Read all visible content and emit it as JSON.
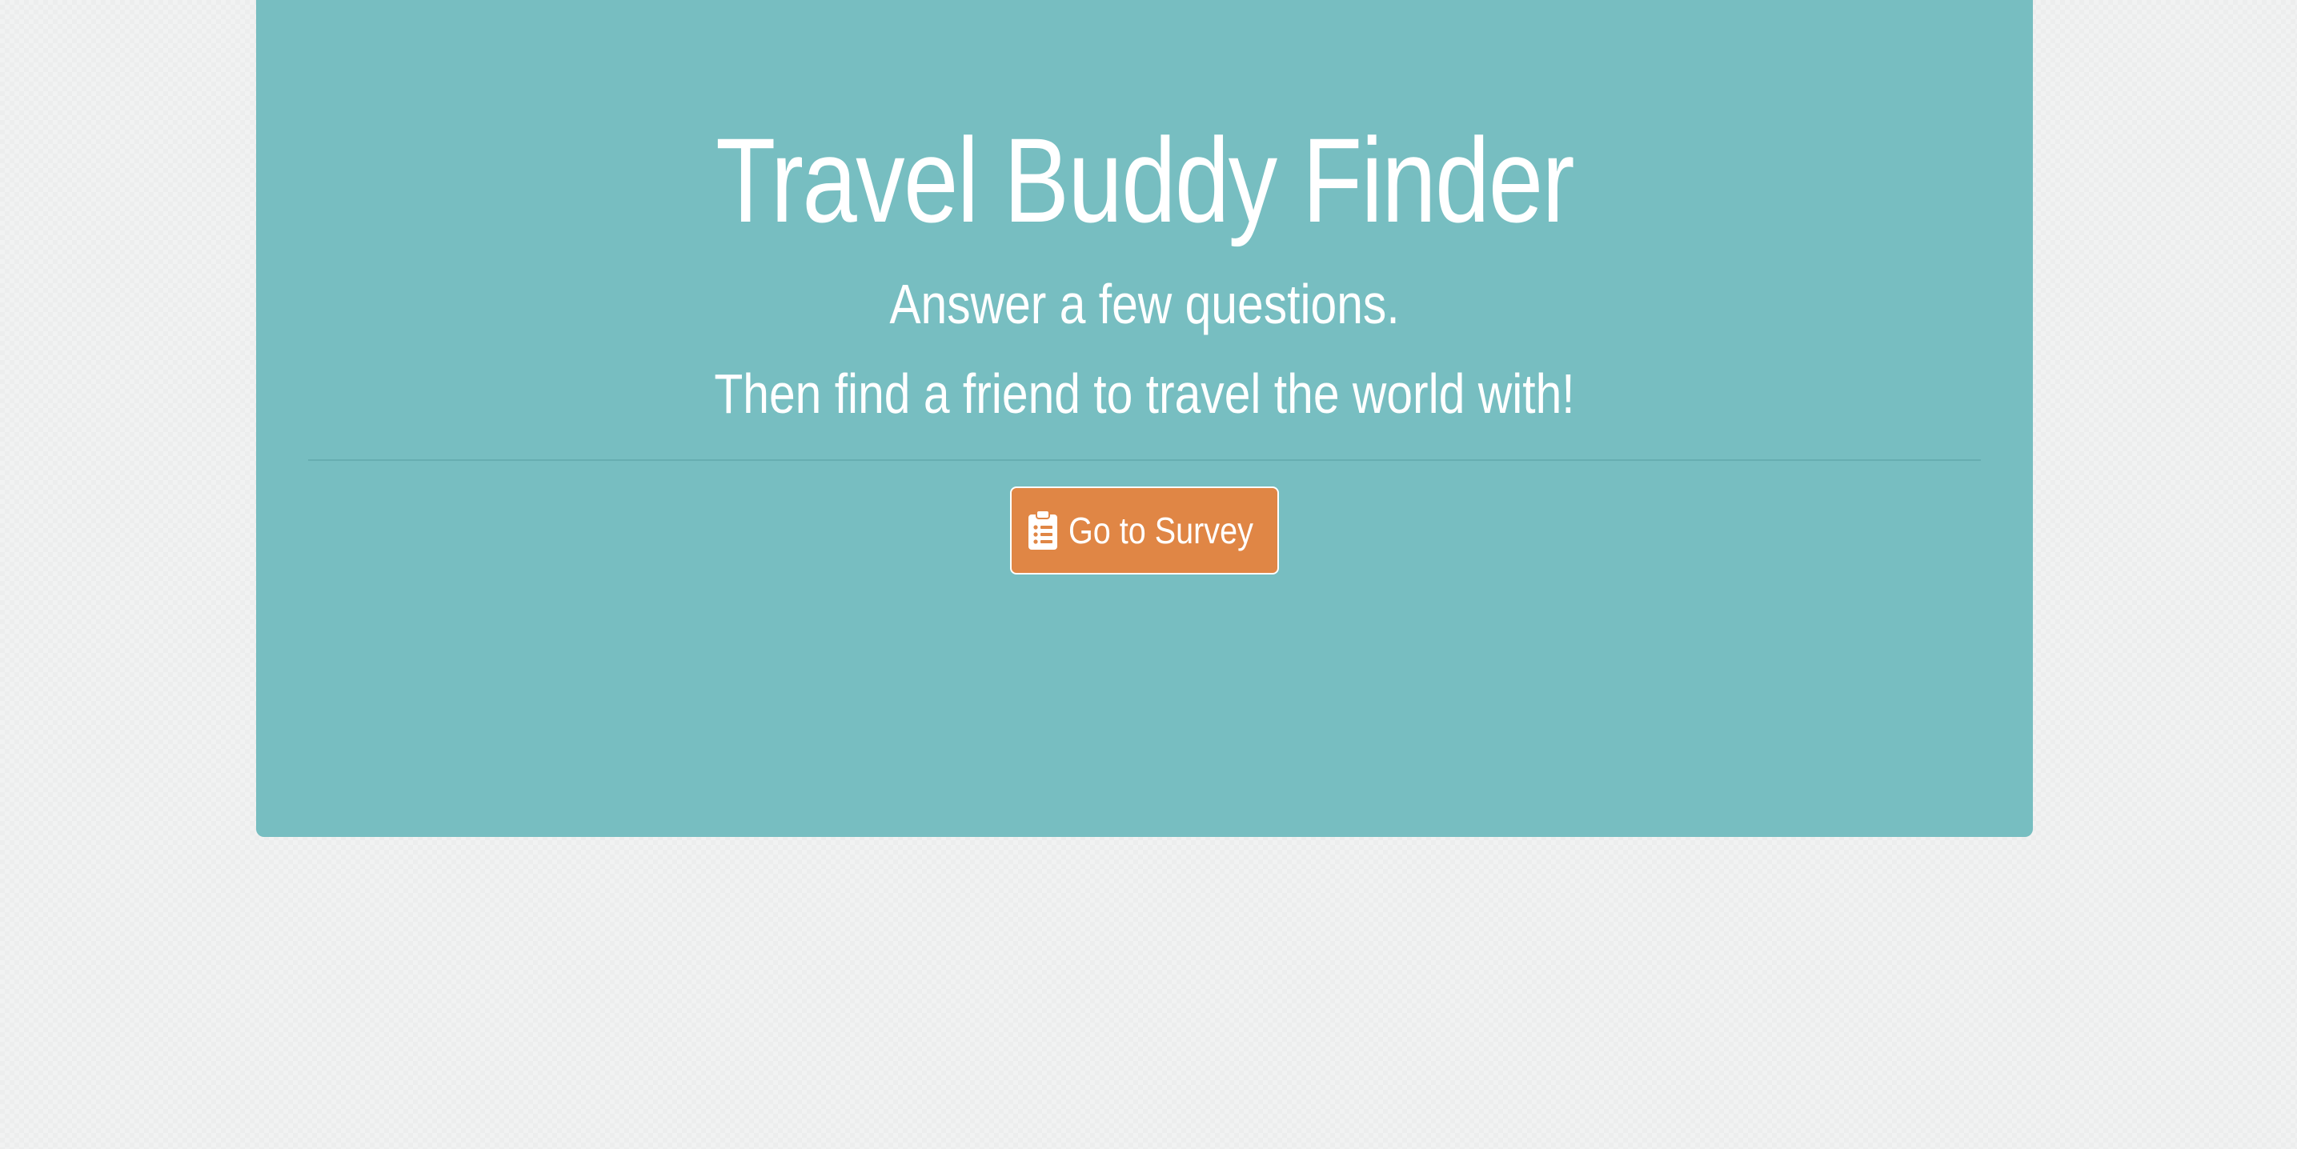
{
  "hero": {
    "title": "Travel Buddy Finder",
    "subtitle_line1": "Answer a few questions.",
    "subtitle_line2": "Then find a friend to travel the world with!",
    "background_color": "#77bec1"
  },
  "survey_button": {
    "label": "Go to Survey",
    "icon": "clipboard-list-icon",
    "background_color": "#e08645"
  }
}
